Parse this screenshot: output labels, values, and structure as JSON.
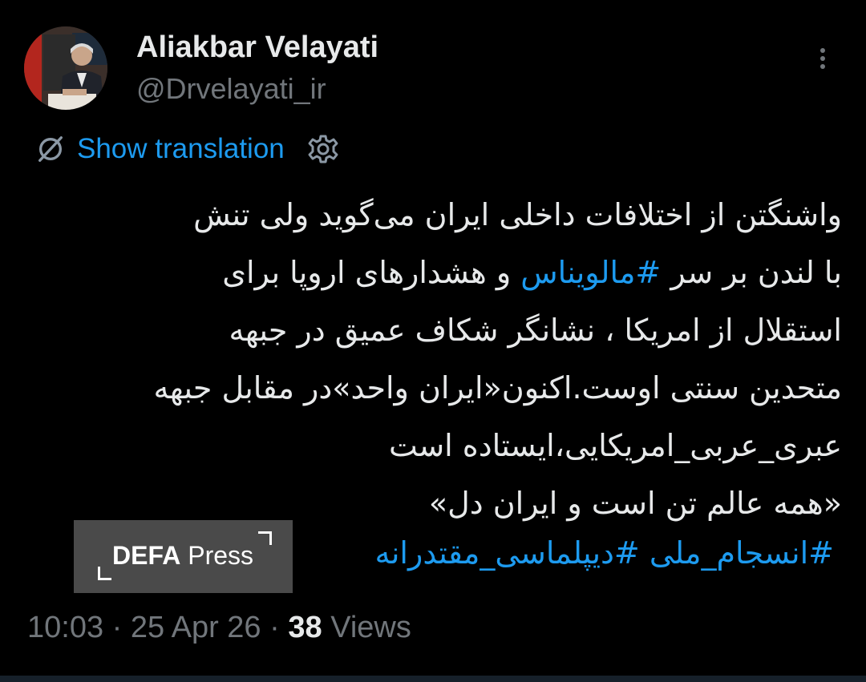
{
  "author": {
    "name": "Aliakbar Velayati",
    "handle": "@Drvelayati_ir"
  },
  "icons": {
    "more": "more-vertical-icon",
    "translate": "globe-off-icon",
    "settings": "gear-icon"
  },
  "translation": {
    "label": "Show translation"
  },
  "tweet": {
    "line1": "واشنگتن از اختلافات داخلی ایران می‌گوید ولی تنش",
    "line2_pre": "با لندن بر سر ",
    "line2_tag": "#مالویناس",
    "line2_post": " و هشدارهای اروپا برای",
    "line3": "استقلال از امریکا ، نشانگر شکاف عمیق در جبهه",
    "line4": "متحدین سنتی اوست.اکنون«ایران واحد»در مقابل جبهه",
    "line5": "عبری_عربی_امریکایی،ایستاده است",
    "line6": "«همه عالم تن است و ایران دل»",
    "hashtag1": "#انسجام_ملی",
    "hashtag2": "#دیپلماسی_مقتدرانه"
  },
  "watermark": {
    "part1": "DEFA",
    "part2": "Press"
  },
  "meta": {
    "time": "10:03",
    "separator": " · ",
    "date": "25 Apr 26",
    "views_count": "38",
    "views_label": "Views"
  },
  "colors": {
    "background": "#000000",
    "text": "#e7e9ea",
    "secondary": "#71767b",
    "link": "#1d9bf0",
    "badge": "#4a4a4a"
  }
}
